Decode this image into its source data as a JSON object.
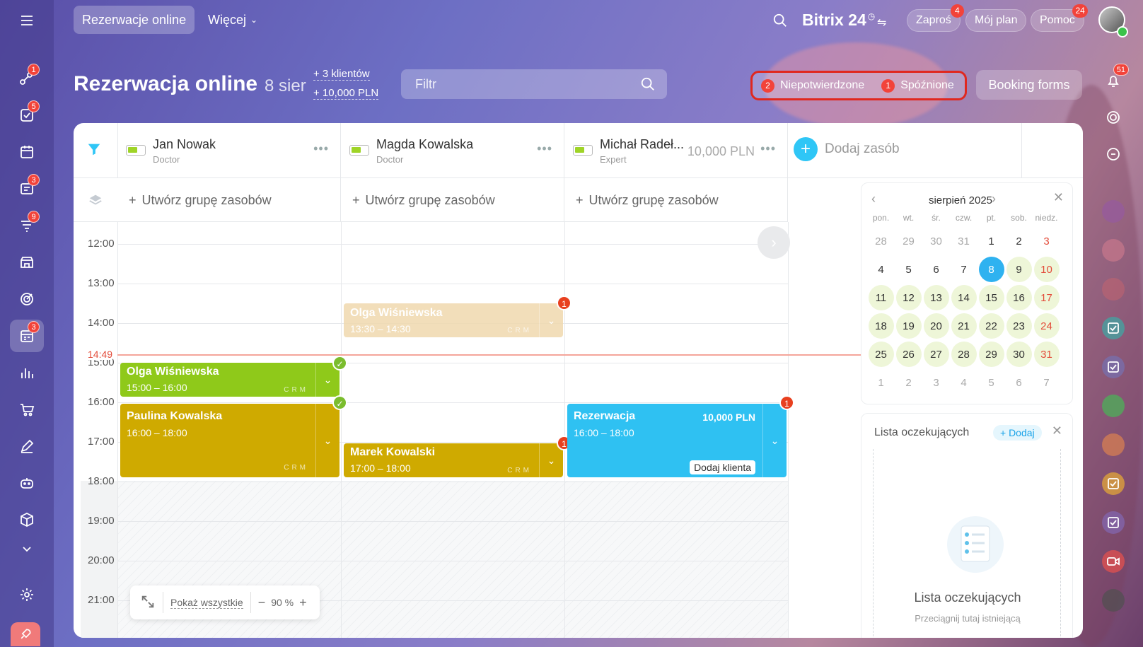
{
  "topbar": {
    "active_tab": "Rezerwacje online",
    "more_tab": "Więcej",
    "brand": "Bitrix 24",
    "invite": "Zaproś",
    "invite_badge": "4",
    "plan": "Mój plan",
    "help": "Pomoc",
    "help_badge": "24"
  },
  "sidebar": {
    "badges": {
      "activity": "1",
      "tasks": "5",
      "feed": "3",
      "filter": "9",
      "booking": "3"
    }
  },
  "header": {
    "title": "Rezerwacja online",
    "date": "8 sier",
    "clients": "+ 3 klientów",
    "revenue": "+ 10,000 PLN",
    "filter_placeholder": "Filtr",
    "unconfirmed_count": "2",
    "unconfirmed_label": "Niepotwierdzone",
    "late_count": "1",
    "late_label": "Spóźnione",
    "booking_forms": "Booking forms",
    "notif_badge": "51"
  },
  "resources": [
    {
      "name": "Jan Nowak",
      "role": "Doctor"
    },
    {
      "name": "Magda Kowalska",
      "role": "Doctor"
    },
    {
      "name": "Michał Radeł...",
      "role": "Expert",
      "price": "10,000 PLN"
    }
  ],
  "add_resource": "Dodaj zasób",
  "create_group": "Utwórz grupę zasobów",
  "times": [
    "12:00",
    "13:00",
    "14:00",
    "15:00",
    "16:00",
    "17:00",
    "18:00",
    "19:00",
    "20:00",
    "21:00"
  ],
  "now": "14:49",
  "bookings": {
    "b1": {
      "name": "Olga Wiśniewska",
      "time": "13:30 – 14:30",
      "badge": "1"
    },
    "b2": {
      "name": "Olga Wiśniewska",
      "time": "15:00 – 16:00"
    },
    "b3": {
      "name": "Paulina Kowalska",
      "time": "16:00 – 18:00"
    },
    "b4": {
      "name": "Marek Kowalski",
      "time": "17:00 – 18:00",
      "badge": "1"
    },
    "b5": {
      "name": "Rezerwacja",
      "time": "16:00 – 18:00",
      "price": "10,000 PLN",
      "add_client": "Dodaj klienta",
      "badge": "1"
    },
    "crm": "CRM"
  },
  "calendar": {
    "month": "sierpień 2025",
    "dow": [
      "pon.",
      "wt.",
      "śr.",
      "czw.",
      "pt.",
      "sob.",
      "niedz."
    ],
    "days": [
      "28",
      "29",
      "30",
      "31",
      "1",
      "2",
      "3",
      "4",
      "5",
      "6",
      "7",
      "8",
      "9",
      "10",
      "11",
      "12",
      "13",
      "14",
      "15",
      "16",
      "17",
      "18",
      "19",
      "20",
      "21",
      "22",
      "23",
      "24",
      "25",
      "26",
      "27",
      "28",
      "29",
      "30",
      "31",
      "1",
      "2",
      "3",
      "4",
      "5",
      "6",
      "7"
    ]
  },
  "waiting": {
    "title": "Lista oczekujących",
    "add": "+ Dodaj",
    "empty_title": "Lista oczekujących",
    "empty_sub": "Przeciągnij tutaj istniejącą"
  },
  "zoom": {
    "show_all": "Pokaż wszystkie",
    "level": "90 %"
  }
}
